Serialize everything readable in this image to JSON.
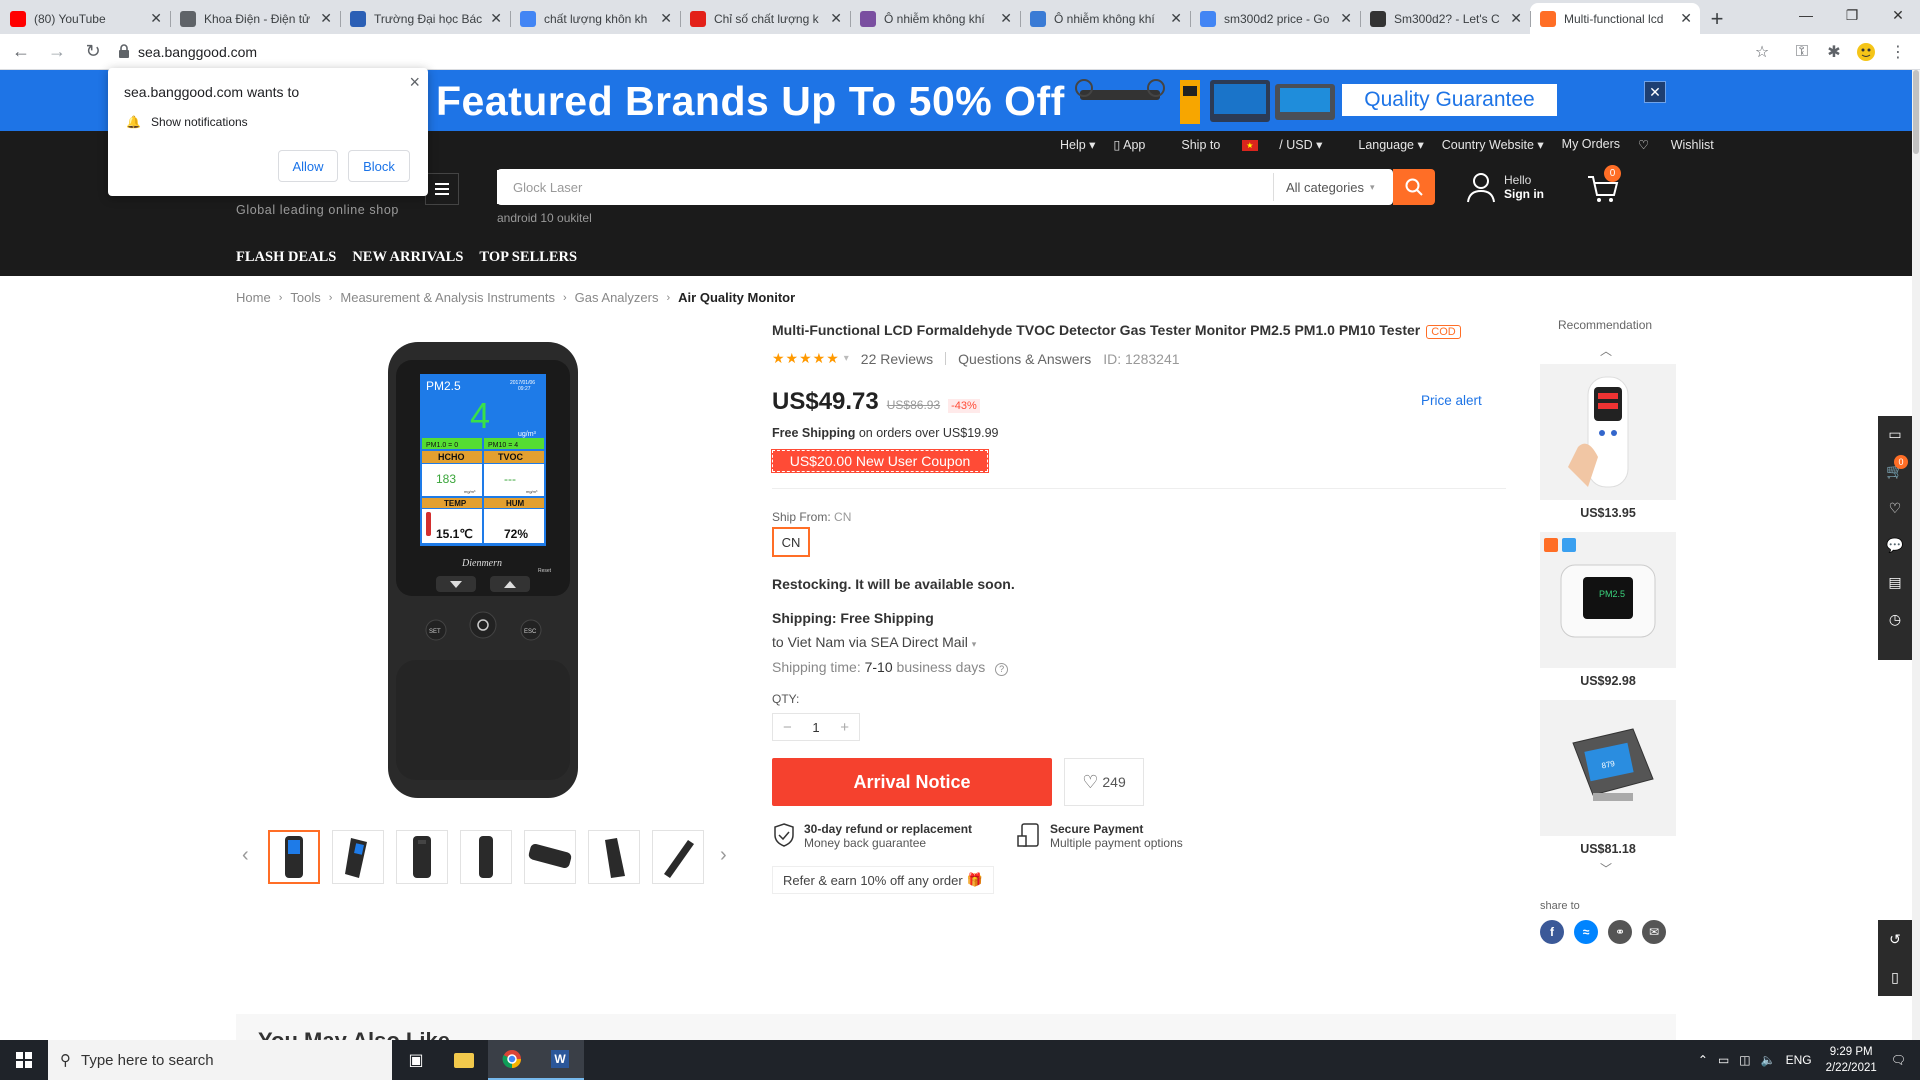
{
  "browser": {
    "tabs": [
      {
        "label": "(80) YouTube",
        "favicon": "youtube-icon",
        "color": "#ff0000"
      },
      {
        "label": "Khoa Điện - Điện tử",
        "favicon": "globe-icon",
        "color": "#5f6368"
      },
      {
        "label": "Trường Đại học Bác",
        "favicon": "university-icon",
        "color": "#2b5fb5"
      },
      {
        "label": "chất lượng khôn kh",
        "favicon": "google-icon",
        "color": "#4285f4"
      },
      {
        "label": "Chỉ số chất lượng k",
        "favicon": "swiss-flag-icon",
        "color": "#e32119"
      },
      {
        "label": "Ô nhiễm không khí",
        "favicon": "flag-icon",
        "color": "#7a4fa0"
      },
      {
        "label": "Ô nhiễm không khí",
        "favicon": "who-icon",
        "color": "#3a7bd5"
      },
      {
        "label": "sm300d2 price - Go",
        "favicon": "google-icon",
        "color": "#4285f4"
      },
      {
        "label": "Sm300d2? - Let's C",
        "favicon": "thermometer-icon",
        "color": "#333333"
      },
      {
        "label": "Multi-functional lcd",
        "favicon": "banggood-icon",
        "color": "#ff6e26"
      }
    ],
    "url": "sea.banggood.com"
  },
  "notification": {
    "title": "sea.banggood.com wants to",
    "body": "Show notifications",
    "allow": "Allow",
    "block": "Block"
  },
  "promo": {
    "text": "Featured Brands Up To 50% Off",
    "quality": "Quality Guarantee"
  },
  "header": {
    "topnav": [
      "Help ▾",
      "App",
      "Ship to",
      "/ USD ▾",
      "Language ▾",
      "Country Website ▾",
      "My Orders",
      "Wishlist"
    ],
    "tagline": "Global leading online shop",
    "search_placeholder": "Glock Laser",
    "search_category": "All categories",
    "search_hint": "android 10 oukitel",
    "hello": "Hello",
    "signin": "Sign in",
    "cart_count": "0",
    "categories": [
      "FLASH DEALS",
      "NEW ARRIVALS",
      "TOP SELLERS"
    ]
  },
  "breadcrumb": [
    "Home",
    "Tools",
    "Measurement & Analysis Instruments",
    "Gas Analyzers",
    "Air Quality Monitor"
  ],
  "product": {
    "title": "Multi-Functional LCD Formaldehyde TVOC Detector Gas Tester Monitor PM2.5 PM1.0 PM10 Tester",
    "cod": "COD",
    "rating": 5,
    "reviews": "22 Reviews",
    "qa": "Questions & Answers",
    "id": "ID: 1283241",
    "price": "US$49.73",
    "old_price": "US$86.93",
    "discount": "-43%",
    "price_alert": "Price alert",
    "free_shipping_bold": "Free Shipping",
    "free_shipping_rest": "on orders over US$19.99",
    "coupon": "US$20.00 New User Coupon",
    "ship_from_label": "Ship From:",
    "ship_from_value": "CN",
    "ship_from_option": "CN",
    "restock": "Restocking. It will be available soon.",
    "shipping_label": "Shipping: Free Shipping",
    "ship_to": "to Viet Nam via SEA Direct Mail",
    "ship_time_label": "Shipping time:",
    "ship_time_value": "7-10",
    "ship_time_unit": "business days",
    "qty_label": "QTY:",
    "qty": "1",
    "arrival_notice": "Arrival Notice",
    "wish_count": "249",
    "refund_title": "30-day refund or replacement",
    "refund_sub": "Money back guarantee",
    "secure_title": "Secure Payment",
    "secure_sub": "Multiple payment options",
    "refer": "Refer & earn 10% off any order",
    "screen": {
      "pm25": "PM2.5",
      "value": "4",
      "unit": "ug/m³",
      "pm10": "PM1.0 = 0",
      "pm100": "PM10 = 4",
      "hcho": "HCHO",
      "tvoc": "TVOC",
      "hcho_val": "183",
      "tvoc_val": "---",
      "temp": "TEMP",
      "hum": "HUM",
      "temp_val": "15.1℃",
      "hum_val": "72%",
      "brand": "Dienmern",
      "set": "SET",
      "esc": "ESC",
      "date": "2017/01/06",
      "time": "09:27",
      "unit_small": "mg/m³",
      "reset": "Reset"
    }
  },
  "recommendation": {
    "title": "Recommendation",
    "items": [
      {
        "price": "US$13.95"
      },
      {
        "price": "US$92.98"
      },
      {
        "price": "US$81.18"
      }
    ],
    "item2_label": "PM2.5",
    "item3_label": "879",
    "share": "share to"
  },
  "rail": {
    "cart_count": "0"
  },
  "bottom": {
    "title": "You May Also Like"
  },
  "taskbar": {
    "search": "Type here to search",
    "lang": "ENG",
    "time": "9:29 PM",
    "date": "2/22/2021"
  }
}
